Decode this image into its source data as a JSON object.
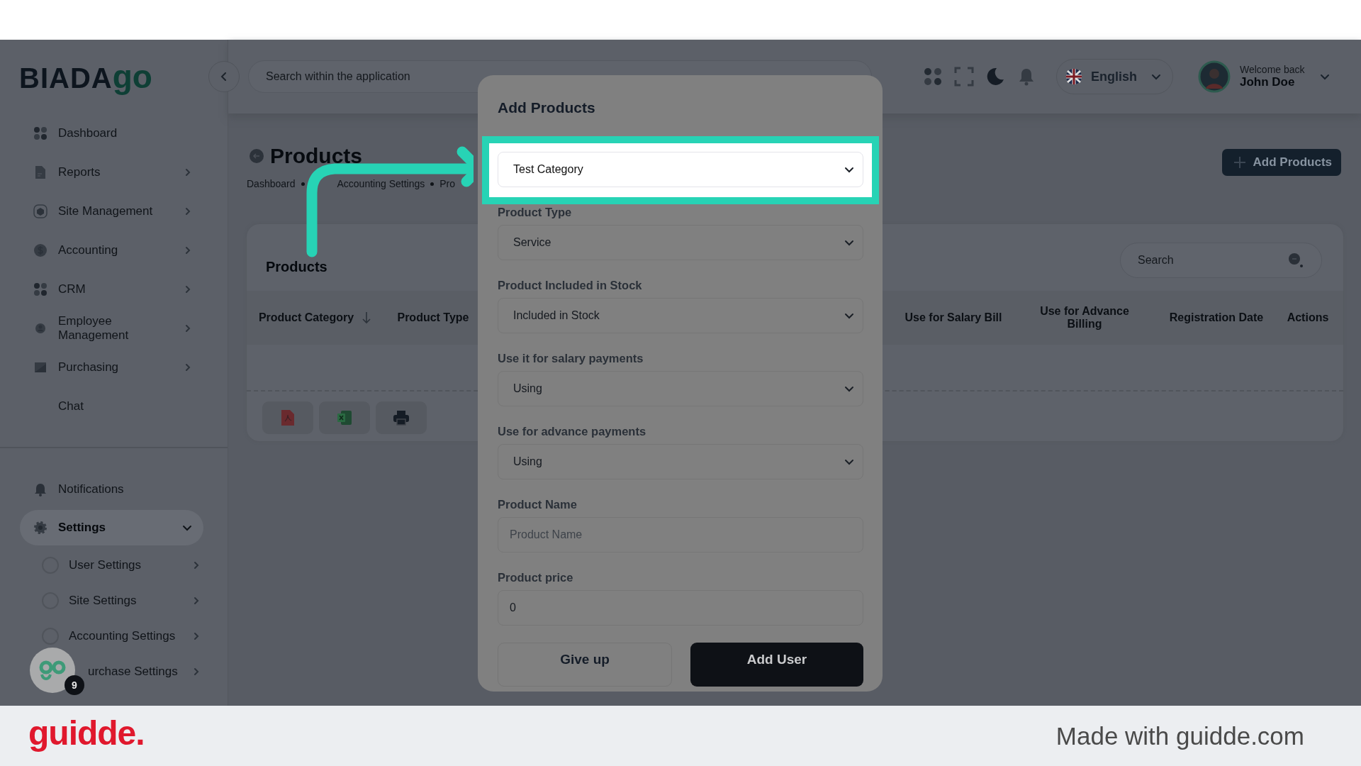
{
  "sidebar": {
    "logo": {
      "text": "BIADA",
      "mark": "go"
    },
    "items": [
      {
        "label": "Dashboard",
        "submenu": false
      },
      {
        "label": "Reports",
        "submenu": true
      },
      {
        "label": "Site Management",
        "submenu": true
      },
      {
        "label": "Accounting",
        "submenu": true
      },
      {
        "label": "CRM",
        "submenu": true
      },
      {
        "label": "Employee Management",
        "submenu": true
      },
      {
        "label": "Purchasing",
        "submenu": true
      },
      {
        "label": "Chat",
        "submenu": false
      }
    ],
    "bottom_items": [
      {
        "label": "Notifications",
        "selected": false
      },
      {
        "label": "Settings",
        "selected": true,
        "expanded": true,
        "children": [
          {
            "label": "User Settings"
          },
          {
            "label": "Site Settings"
          },
          {
            "label": "Accounting Settings"
          },
          {
            "label": "urchase Settings"
          }
        ]
      }
    ]
  },
  "assistant": {
    "badge": "9"
  },
  "header": {
    "search": {
      "placeholder": "Search within the application"
    },
    "language": "English",
    "user": {
      "greeting": "Welcome back",
      "name": "John Doe"
    }
  },
  "page": {
    "title": "Products",
    "breadcrumb": [
      "Dashboard",
      "Accounting Settings",
      "Pro"
    ],
    "add_button": "Add Products",
    "card": {
      "title": "Products",
      "search": {
        "placeholder": "Search"
      },
      "columns": [
        {
          "label": "Product Category",
          "sorted": true
        },
        {
          "label": "Product Type",
          "sorted": false
        },
        {
          "label": "Use for Salary Bill",
          "sorted": false
        },
        {
          "label": "Use for Advance Billing",
          "sorted": false
        },
        {
          "label": "Registration Date",
          "sorted": false
        },
        {
          "label": "Actions",
          "sorted": false
        }
      ]
    }
  },
  "modal": {
    "title": "Add Products",
    "fields": [
      {
        "kind": "select",
        "value": "Test Category",
        "highlighted": true
      },
      {
        "kind": "select",
        "label": "Product Type",
        "value": "Service",
        "highlighted": false
      },
      {
        "kind": "select",
        "label": "Product Included in Stock",
        "value": "Included in Stock",
        "highlighted": false
      },
      {
        "kind": "select",
        "label": "Use it for salary payments",
        "value": "Using",
        "highlighted": false
      },
      {
        "kind": "select",
        "label": "Use for advance payments",
        "value": "Using",
        "highlighted": false
      },
      {
        "kind": "text",
        "label": "Product Name",
        "placeholder": "Product Name",
        "highlighted": false
      },
      {
        "kind": "text",
        "label": "Product price",
        "value": "0",
        "highlighted": false
      }
    ],
    "buttons": [
      {
        "label": "Give up",
        "kind": "secondary"
      },
      {
        "label": "Add User",
        "kind": "primary"
      }
    ]
  },
  "footer": {
    "logo": "guidde.",
    "text": "Made with guidde.com"
  }
}
